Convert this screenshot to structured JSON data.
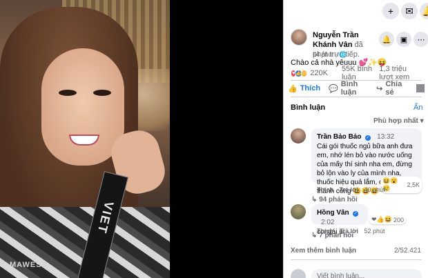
{
  "video": {
    "sash_text": "VIET",
    "watermark": "MAWESA"
  },
  "topbar": {
    "buttons": [
      {
        "icon": "plus-icon",
        "glyph": "+"
      },
      {
        "icon": "messenger-icon",
        "glyph": "✉"
      },
      {
        "icon": "bell-icon",
        "glyph": "🔔"
      }
    ]
  },
  "post": {
    "author": "Nguyễn Trần Khánh Vân",
    "author_suffix": "đã phát trực tiếp.",
    "time": "54 phút · 🌐",
    "caption": "Chào cả nhà yêuuu 💕✨😝",
    "reaction_count": "220K",
    "comment_count": "55K bình luận",
    "view_count": "1,3 triệu lượt xem",
    "actions": {
      "like": "Thích",
      "comment": "Bình luận",
      "share": "Chia sẻ"
    }
  },
  "comments_section": {
    "title": "Bình luận",
    "hide": "Ẩn",
    "sort": "Phù hợp nhất ▾",
    "items": [
      {
        "name": "Trần Bảo Bảo",
        "time": "13:32",
        "text": "Cái gói thuốc ngủ bữa anh đưa em, nhớ lén bỏ vào nước uống của mấy thí sinh nha em, đừng bỏ lộn vào ly của mình nha, thuốc hiệu quả lắm, chúc em thành công 😆😆😆",
        "like": "Thích",
        "reply": "Trả lời",
        "ago": "40 phút",
        "reactions": "2,5K",
        "replies": "↳ 94 phản hồi"
      },
      {
        "name": "Hồng Vân",
        "time": "2:02",
        "text": "congái ui",
        "like": "Thích",
        "reply": "Trả lời",
        "ago": "52 phút",
        "reactions": "200",
        "replies": "↳ 7 phản hồi"
      }
    ],
    "more": "Xem thêm bình luận",
    "total": "2/52.421",
    "write_placeholder": "Viết bình luận..."
  },
  "colors": {
    "accent": "#1877f2",
    "bubble": "#f0f2f5",
    "muted": "#65676b"
  }
}
